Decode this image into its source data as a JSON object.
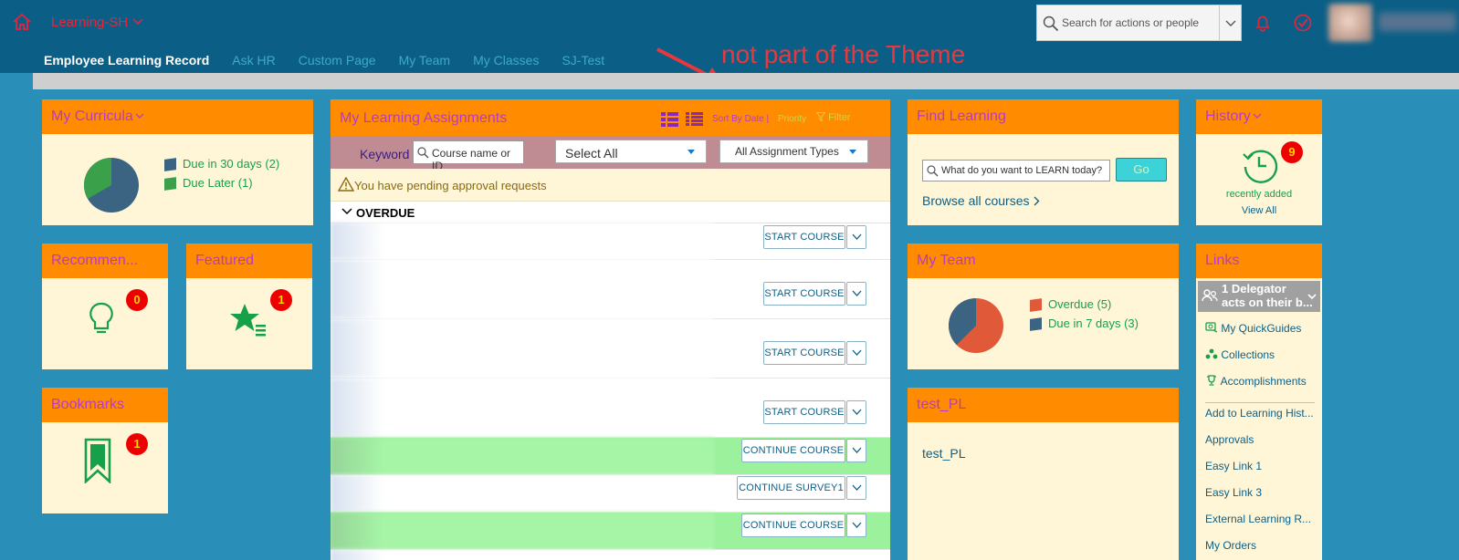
{
  "header": {
    "app_title": "Learning-SH",
    "search_placeholder": "Search for actions or people",
    "nav": [
      "Employee Learning Record",
      "Ask HR",
      "Custom Page",
      "My Team",
      "My Classes",
      "SJ-Test"
    ]
  },
  "annotation": "not part of the Theme",
  "colors": {
    "header": "#0b5f86",
    "card_header": "#ff8c00",
    "card_title": "#b63cc8",
    "card_body": "#fff6d8",
    "badge": "#e00000"
  },
  "curricula": {
    "title": "My Curricula",
    "legend": [
      "Due in 30 days (2)",
      "Due Later (1)"
    ],
    "values": [
      2,
      1
    ],
    "colors": [
      "#3a6481",
      "#3aa04a"
    ]
  },
  "recommended": {
    "title": "Recommen...",
    "badge": "0"
  },
  "featured": {
    "title": "Featured",
    "badge": "1"
  },
  "bookmarks": {
    "title": "Bookmarks",
    "badge": "1"
  },
  "assignments": {
    "title": "My Learning Assignments",
    "sort_by": "Sort By Date |",
    "priority": "Priority",
    "filter": "Filter",
    "keyword_label": "Keyword",
    "keyword_placeholder": "Course name or ID",
    "select_all": "Select All",
    "types": "All Assignment Types",
    "pending": "You have pending approval requests",
    "overdue": "OVERDUE",
    "rows": [
      {
        "label": "START COURSE"
      },
      {
        "label": "START COURSE"
      },
      {
        "label": "START COURSE"
      },
      {
        "label": "START COURSE"
      },
      {
        "label": "CONTINUE COURSE"
      },
      {
        "label": "CONTINUE SURVEY1"
      },
      {
        "label": "CONTINUE COURSE"
      }
    ]
  },
  "find_learning": {
    "title": "Find Learning",
    "placeholder": "What do you want to LEARN today?",
    "go": "Go",
    "browse": "Browse all courses"
  },
  "my_team": {
    "title": "My Team",
    "legend": [
      "Overdue (5)",
      "Due in 7 days (3)"
    ],
    "values": [
      5,
      3
    ],
    "colors": [
      "#e05a3a",
      "#3a6481"
    ]
  },
  "test_pl": {
    "title": "test_PL",
    "link": "test_PL"
  },
  "history": {
    "title": "History",
    "badge": "9",
    "recent": "recently added",
    "view_all": "View All"
  },
  "links": {
    "title": "Links",
    "delegator_line1": "1 Delegator",
    "delegator_line2": "acts on their b...",
    "items": [
      "My QuickGuides",
      "Collections",
      "Accomplishments",
      "Add to Learning Hist...",
      "Approvals",
      "Easy Link 1",
      "Easy Link 3",
      "External Learning R...",
      "My Orders"
    ]
  }
}
